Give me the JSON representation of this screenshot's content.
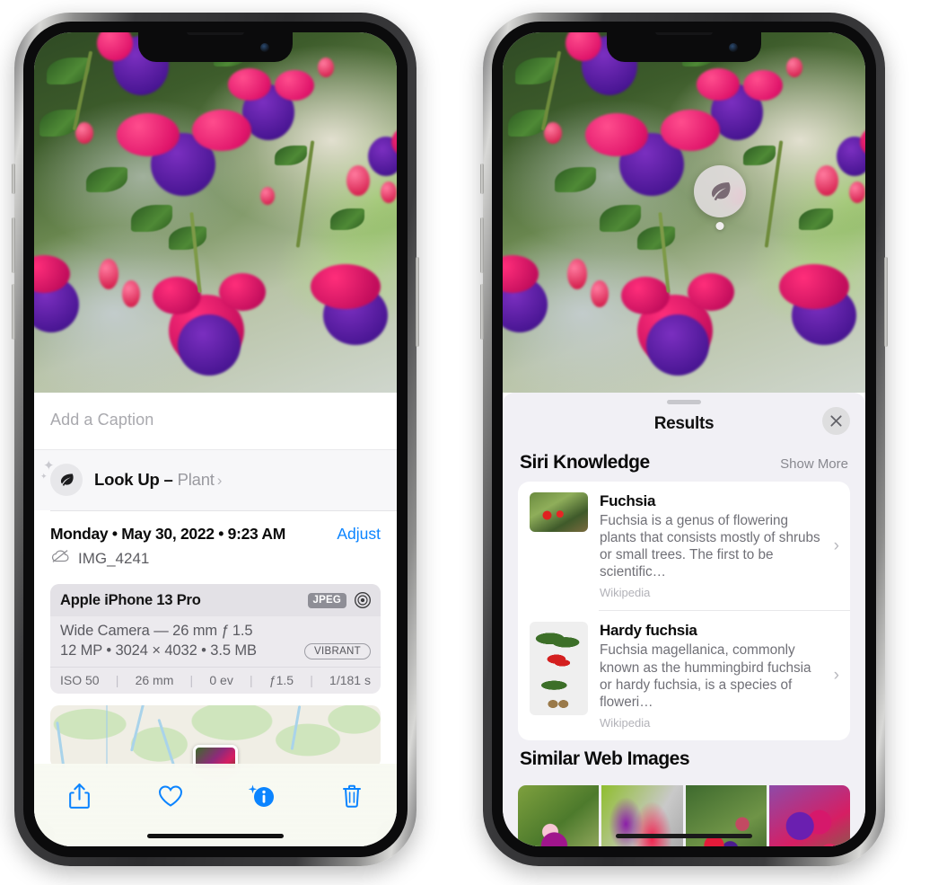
{
  "left_phone": {
    "caption_placeholder": "Add a Caption",
    "lookup": {
      "icon": "leaf-icon",
      "label": "Look Up – ",
      "subject": "Plant",
      "chevron": "›"
    },
    "meta": {
      "date": "Monday • May 30, 2022 • 9:23 AM",
      "adjust_label": "Adjust",
      "filename": "IMG_4241",
      "cloud_icon": "icloud-slash-icon"
    },
    "camera_card": {
      "model": "Apple iPhone 13 Pro",
      "format_badge": "JPEG",
      "aperture_icon": "aperture-icon",
      "lens_line": "Wide Camera — 26 mm ƒ 1.5",
      "size_line": "12 MP • 3024 × 4032 • 3.5 MB",
      "style_badge": "VIBRANT",
      "exif": [
        "ISO 50",
        "26 mm",
        "0 ev",
        "ƒ1.5",
        "1/181 s"
      ]
    },
    "toolbar": [
      {
        "name": "share-button",
        "icon": "share-icon"
      },
      {
        "name": "favorite-button",
        "icon": "heart-icon"
      },
      {
        "name": "info-button",
        "icon": "info-sparkle-icon"
      },
      {
        "name": "delete-button",
        "icon": "trash-icon"
      }
    ],
    "accent_color": "#0b84ff"
  },
  "right_phone": {
    "badge_icon": "leaf-icon",
    "results": {
      "title": "Results",
      "close_icon": "close-icon",
      "siri_knowledge": {
        "heading": "Siri Knowledge",
        "show_more": "Show More",
        "items": [
          {
            "title": "Fuchsia",
            "description": "Fuchsia is a genus of flowering plants that consists mostly of shrubs or small trees. The first to be scientific…",
            "source": "Wikipedia",
            "chevron": "›"
          },
          {
            "title": "Hardy fuchsia",
            "description": "Fuchsia magellanica, commonly known as the hummingbird fuchsia or hardy fuchsia, is a species of floweri…",
            "source": "Wikipedia",
            "chevron": "›"
          }
        ]
      },
      "similar_web_images": {
        "heading": "Similar Web Images",
        "count": 4
      }
    }
  }
}
